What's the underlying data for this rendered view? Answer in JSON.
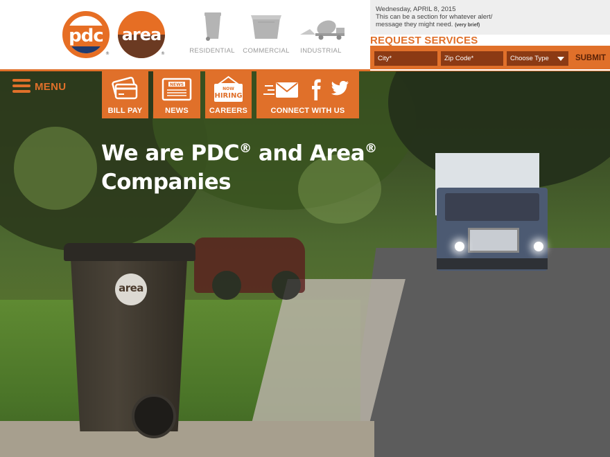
{
  "header": {
    "logos": [
      {
        "name": "pdc",
        "text": "pdc"
      },
      {
        "name": "area",
        "text": "area"
      }
    ],
    "services": [
      {
        "label": "RESIDENTIAL",
        "icon": "trash-bin-icon"
      },
      {
        "label": "COMMERCIAL",
        "icon": "dumpster-icon"
      },
      {
        "label": "INDUSTRIAL",
        "icon": "concrete-truck-icon"
      }
    ]
  },
  "alert": {
    "date": "Wednesday, APRIL 8, 2015",
    "message": "This can be a section for whatever alert/ message they might need.",
    "brief": "(very brief)"
  },
  "request": {
    "title": "REQUEST SERVICES",
    "city_placeholder": "City*",
    "zip_placeholder": "Zip Code*",
    "type_selected": "Choose Type",
    "submit_label": "SUBMIT"
  },
  "nav": {
    "menu_label": "MENU",
    "tiles": [
      {
        "label": "BILL PAY",
        "icon": "credit-card-icon"
      },
      {
        "label": "NEWS",
        "icon": "newspaper-icon"
      },
      {
        "label": "CAREERS",
        "icon": "now-hiring-sign-icon",
        "sign_top": "NOW",
        "sign_bottom": "HIRING"
      },
      {
        "label": "CONNECT WITH US",
        "icon": "email-facebook-twitter-icons"
      }
    ],
    "news_sign": "NEWS"
  },
  "hero": {
    "headline_part1": "We are PDC",
    "headline_part2": " and Area",
    "headline_part3": "Companies",
    "reg_mark": "®",
    "bin_logo": "area"
  },
  "colors": {
    "accent": "#e0702a",
    "navy": "#1f3a6e",
    "brown": "#6b3a22",
    "dark_orange": "#8b3a14"
  }
}
